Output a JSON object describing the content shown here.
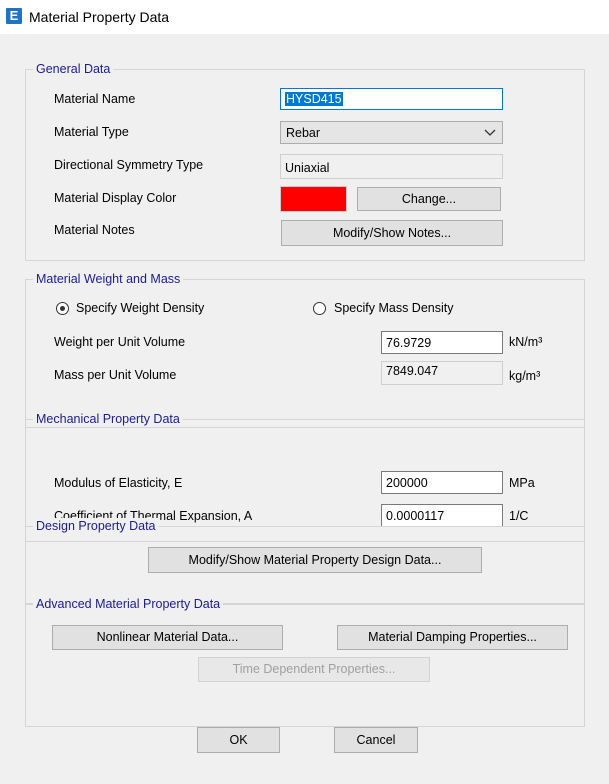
{
  "window": {
    "title": "Material Property Data",
    "icon": "E"
  },
  "general": {
    "legend": "General Data",
    "material_name_label": "Material Name",
    "material_name_value": "HYSD415",
    "material_type_label": "Material Type",
    "material_type_value": "Rebar",
    "symmetry_label": "Directional Symmetry Type",
    "symmetry_value": "Uniaxial",
    "display_color_label": "Material Display Color",
    "display_color": "#ff0000",
    "change_button": "Change...",
    "notes_label": "Material Notes",
    "notes_button": "Modify/Show Notes..."
  },
  "weight": {
    "legend": "Material Weight and Mass",
    "radio_weight": "Specify Weight Density",
    "radio_mass": "Specify Mass Density",
    "selected": "weight",
    "weight_label": "Weight per Unit Volume",
    "weight_value": "76.9729",
    "weight_unit": "kN/m³",
    "mass_label": "Mass per Unit Volume",
    "mass_value": "7849.047",
    "mass_unit": "kg/m³"
  },
  "mechanical": {
    "legend": "Mechanical Property Data",
    "modulus_label": "Modulus of Elasticity,  E",
    "modulus_value": "200000",
    "modulus_unit": "MPa",
    "thermal_label": "Coefficient of Thermal Expansion,  A",
    "thermal_value": "0.0000117",
    "thermal_unit": "1/C"
  },
  "design": {
    "legend": "Design Property Data",
    "button": "Modify/Show Material Property Design Data..."
  },
  "advanced": {
    "legend": "Advanced Material Property Data",
    "nonlinear_button": "Nonlinear Material Data...",
    "damping_button": "Material Damping Properties...",
    "time_button": "Time Dependent Properties..."
  },
  "footer": {
    "ok": "OK",
    "cancel": "Cancel"
  }
}
